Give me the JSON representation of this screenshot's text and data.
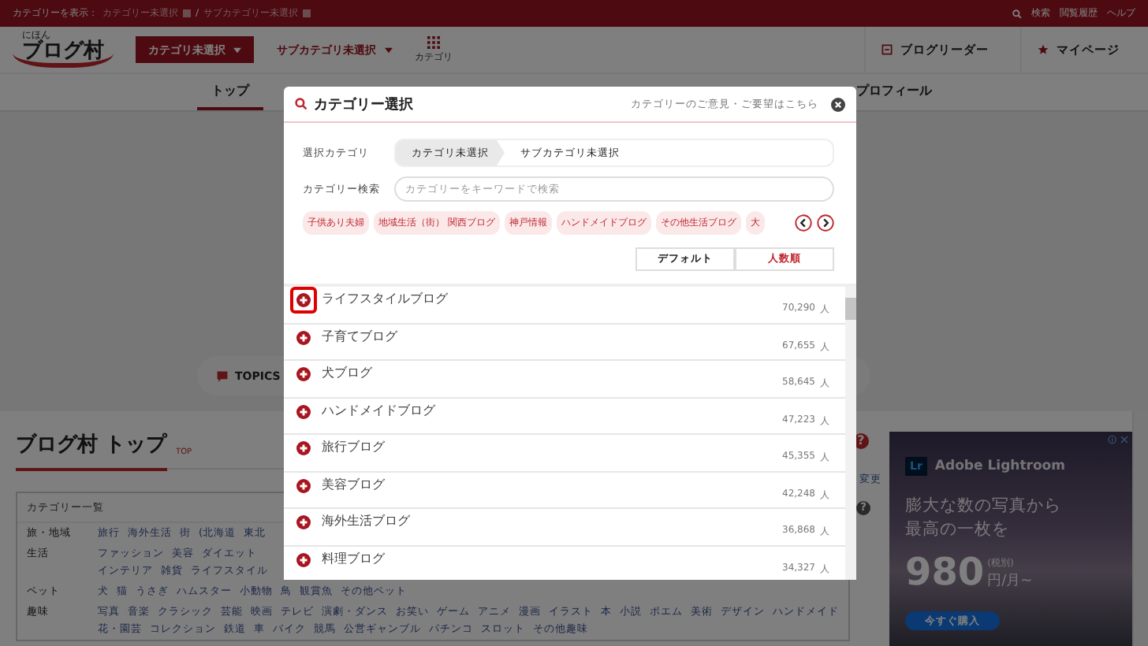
{
  "top_bar": {
    "label": "カテゴリーを表示：",
    "category": "カテゴリー未選択",
    "separator": "/",
    "subcategory": "サブカテゴリー未選択",
    "links": [
      "検索",
      "閲覧履歴",
      "ヘルプ"
    ]
  },
  "header": {
    "logo_small": "にほん",
    "logo": "ブログ村",
    "category_button": "カテゴリ未選択",
    "subcategory_button": "サブカテゴリ未選択",
    "grid_label": "カテゴリ",
    "links": [
      {
        "label": "ブログリーダー",
        "kind": "reader"
      },
      {
        "label": "マイページ",
        "kind": "mypage"
      }
    ]
  },
  "nav": [
    {
      "label": "トップ",
      "selected": true
    },
    {
      "label": "プロフィール",
      "selected": false
    }
  ],
  "topics": {
    "label": "TOPICS"
  },
  "page_title": {
    "title": "ブログ村 トップ",
    "tag": "TOP",
    "help": "?"
  },
  "change_link": "変更",
  "category_list": {
    "title": "カテゴリー一覧",
    "help": "?",
    "rows": [
      {
        "label": "旅・地域",
        "lines": [
          [
            "旅行",
            "海外生活",
            "街",
            "(北海道",
            "東北"
          ]
        ]
      },
      {
        "label": "生活",
        "lines": [
          [
            "ファッション",
            "美容",
            "ダイエット"
          ],
          [
            "インテリア",
            "雑貨",
            "ライフスタイル"
          ]
        ]
      },
      {
        "label": "ペット",
        "lines": [
          [
            "犬",
            "猫",
            "うさぎ",
            "ハムスター",
            "小動物",
            "鳥",
            "観賞魚",
            "その他ペット"
          ]
        ]
      },
      {
        "label": "趣味",
        "lines": [
          [
            "写真",
            "音楽",
            "クラシック",
            "芸能",
            "映画",
            "テレビ",
            "演劇・ダンス",
            "お笑い",
            "ゲーム",
            "アニメ",
            "漫画",
            "イラスト",
            "本",
            "小説",
            "ポエム",
            "美術",
            "デザイン",
            "ハンドメイド"
          ],
          [
            "花・園芸",
            "コレクション",
            "鉄道",
            "車",
            "バイク",
            "競馬",
            "公営ギャンブル",
            "パチンコ",
            "スロット",
            "その他趣味"
          ]
        ]
      }
    ]
  },
  "ad": {
    "logo": "Lr",
    "brand": "Adobe Lightroom",
    "headline": [
      "膨大な数の写真から",
      "最高の一枚を"
    ],
    "price": "980",
    "tax_note": "(税別)",
    "unit": "円/月~",
    "button": "今すぐ購入"
  },
  "modal": {
    "title": "カテゴリー選択",
    "feedback_link": "カテゴリーのご意見・ご要望はこちら",
    "selected_label": "選択カテゴリ",
    "breadcrumb": [
      "カテゴリ未選択",
      "サブカテゴリ未選択"
    ],
    "search_label": "カテゴリー検索",
    "search": {
      "placeholder": "カテゴリーをキーワードで検索"
    },
    "tags": [
      "子供あり夫婦",
      "地域生活（街） 関西ブログ",
      "神戸情報",
      "ハンドメイドブログ",
      "その他生活ブログ",
      "大"
    ],
    "sort": [
      {
        "label": "デフォルト",
        "selected": false
      },
      {
        "label": "人数順",
        "selected": true
      }
    ],
    "items": [
      {
        "name": "ライフスタイルブログ",
        "count": "70,290",
        "unit": "人",
        "highlighted": true
      },
      {
        "name": "子育てブログ",
        "count": "67,655",
        "unit": "人",
        "highlighted": false
      },
      {
        "name": "犬ブログ",
        "count": "58,645",
        "unit": "人",
        "highlighted": false
      },
      {
        "name": "ハンドメイドブログ",
        "count": "47,223",
        "unit": "人",
        "highlighted": false
      },
      {
        "name": "旅行ブログ",
        "count": "45,355",
        "unit": "人",
        "highlighted": false
      },
      {
        "name": "美容ブログ",
        "count": "42,248",
        "unit": "人",
        "highlighted": false
      },
      {
        "name": "海外生活ブログ",
        "count": "36,868",
        "unit": "人",
        "highlighted": false
      },
      {
        "name": "料理ブログ",
        "count": "34,327",
        "unit": "人",
        "highlighted": false
      }
    ]
  }
}
